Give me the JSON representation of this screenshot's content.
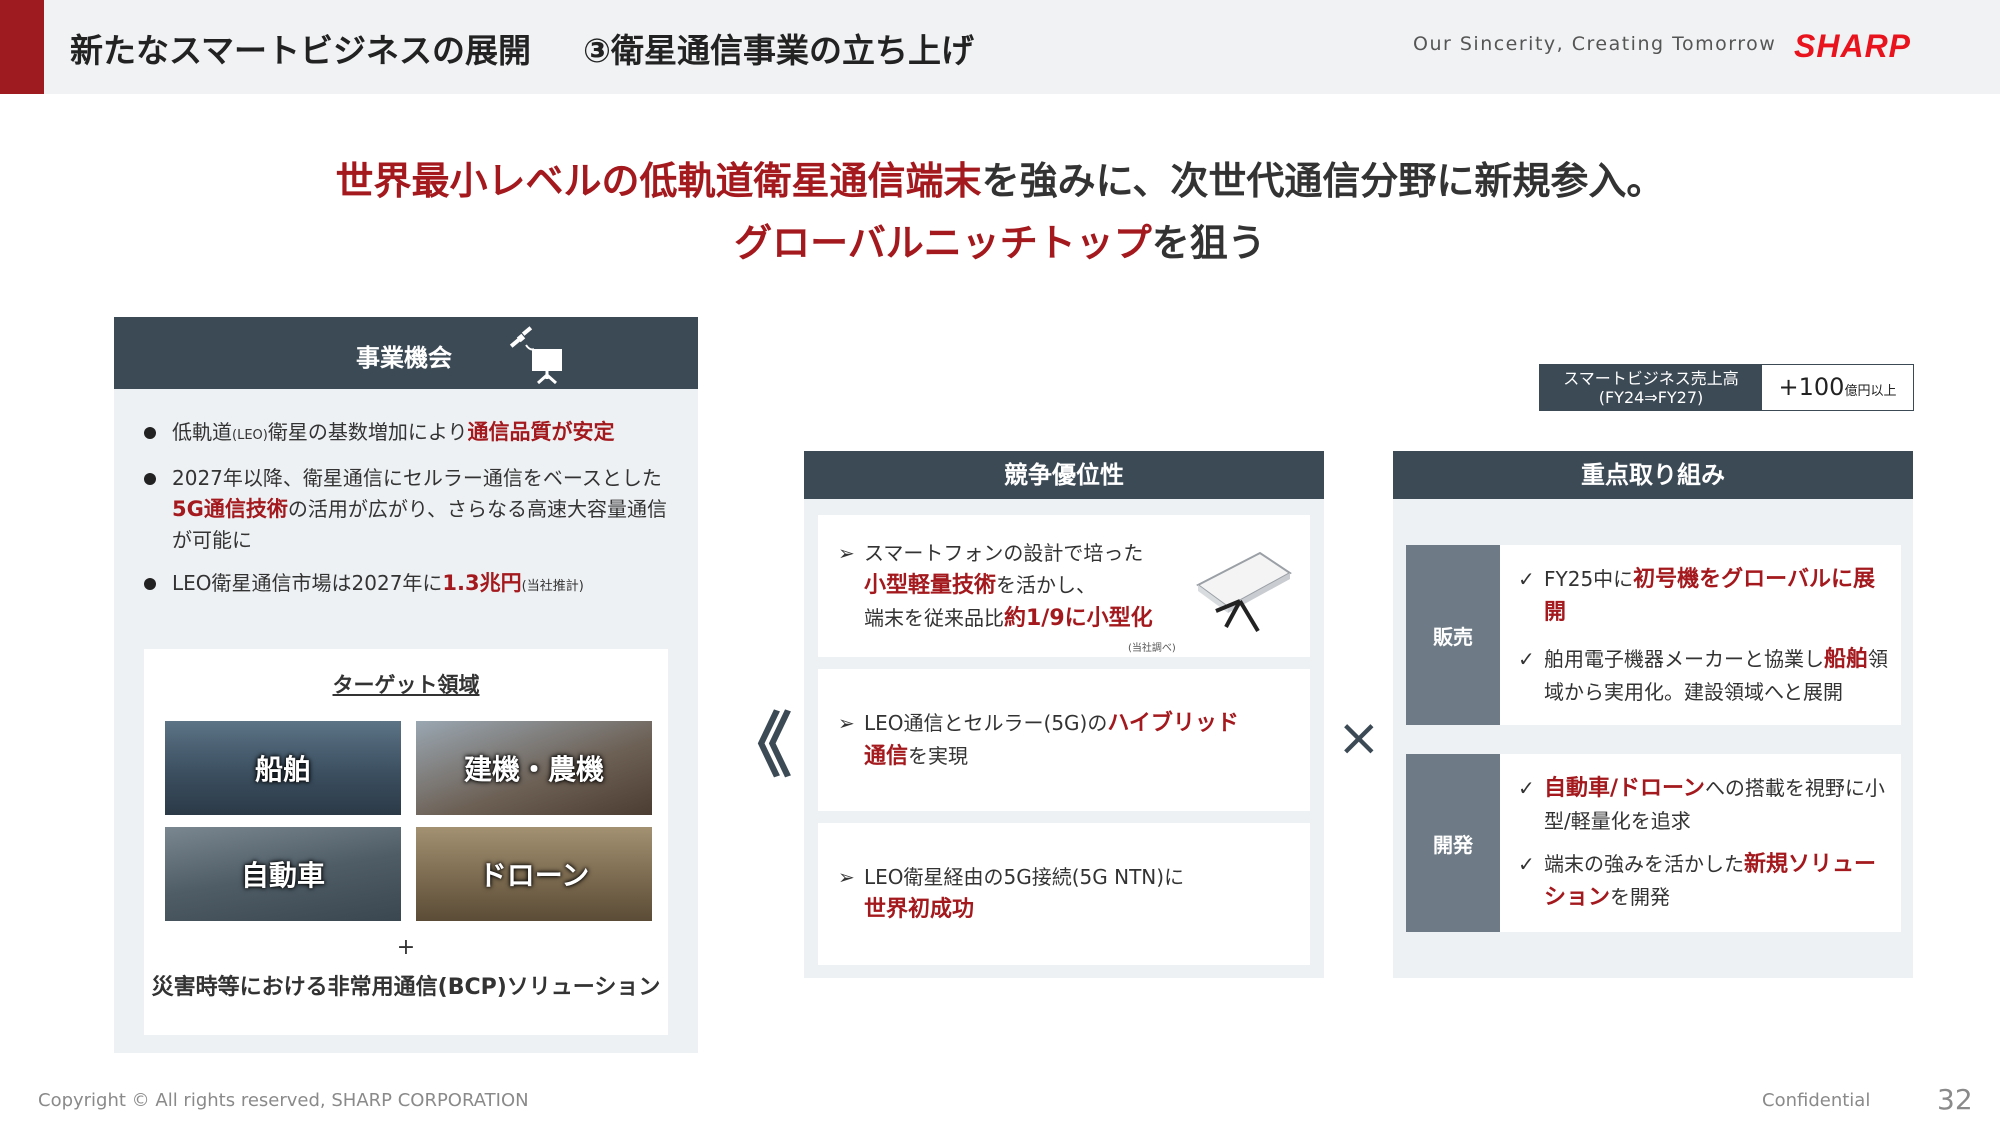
{
  "header": {
    "title": "新たなスマートビジネスの展開",
    "subtitle": "③衛星通信事業の立ち上げ",
    "tagline": "Our Sincerity, Creating Tomorrow",
    "logo": "SHARP",
    "accent_color": "#9e1b1f"
  },
  "headline": {
    "line1_red": "世界最小レベルの低軌道衛星通信端末",
    "line1_rest": "を強みに、次世代通信分野に新規参入。",
    "line2_red": "グローバルニッチトップ",
    "line2_rest": "を狙う"
  },
  "opportunity": {
    "title": "事業機会",
    "icon": "satellite-icon",
    "bullets": [
      {
        "a": "低軌道",
        "small": "(LEO)",
        "b": "衛星の基数増加により",
        "red": "通信品質が安定"
      },
      {
        "a": "2027年以降、衛星通信にセルラー通信をベースとした",
        "red": "5G通信技術",
        "b": "の活用が広がり、さらなる高速大容量通信が可能に"
      },
      {
        "a": "LEO衛星通信市場は2027年に",
        "red": "1.3兆円",
        "small": "(当社推計)"
      }
    ],
    "target": {
      "title": "ターゲット領域",
      "tiles": [
        "船舶",
        "建機・農機",
        "自動車",
        "ドローン"
      ],
      "plus": "+",
      "bcp": "災害時等における非常用通信(BCP)ソリューション"
    }
  },
  "advantage": {
    "title": "競争優位性",
    "cards": [
      {
        "l1": "スマートフォンの設計で培った",
        "red1": "小型軽量技術",
        "l2": "を活かし、",
        "l3": "端末を従来品比",
        "red2": "約1/9に小型化",
        "note": "(当社調べ)",
        "icon": "terminal-device-icon"
      },
      {
        "l1": "LEO通信とセルラー(5G)の",
        "red1": "ハイブリッド",
        "red2": "通信",
        "l2": "を実現"
      },
      {
        "l1": "LEO衛星経由の5G接続(5G NTN)に",
        "red1": "世界初成功"
      }
    ]
  },
  "sales_box": {
    "label_l1": "スマートビジネス売上高",
    "label_l2": "(FY24⇒FY27)",
    "value": "+100",
    "unit": "億円以上"
  },
  "focus": {
    "title": "重点取り組み",
    "groups": [
      {
        "label": "販売",
        "items": [
          {
            "a": "FY25中に",
            "red": "初号機をグローバルに展開",
            "b": ""
          },
          {
            "a": "舶用電子機器メーカーと協業し",
            "red": "船舶",
            "b": "領域から実用化。建設領域へと展開"
          }
        ]
      },
      {
        "label": "開発",
        "items": [
          {
            "a": "",
            "red": "自動車/ドローン",
            "b": "への搭載を視野に小型/軽量化を追求"
          },
          {
            "a": "端末の強みを活かした",
            "red": "新規ソリューション",
            "b": "を開発"
          }
        ]
      }
    ]
  },
  "symbols": {
    "chevron": "《",
    "times": "×",
    "arrow": "➢",
    "check": "✓"
  },
  "footer": {
    "copyright": "Copyright © All rights reserved, SHARP CORPORATION",
    "confidential": "Confidential",
    "page": "32"
  }
}
